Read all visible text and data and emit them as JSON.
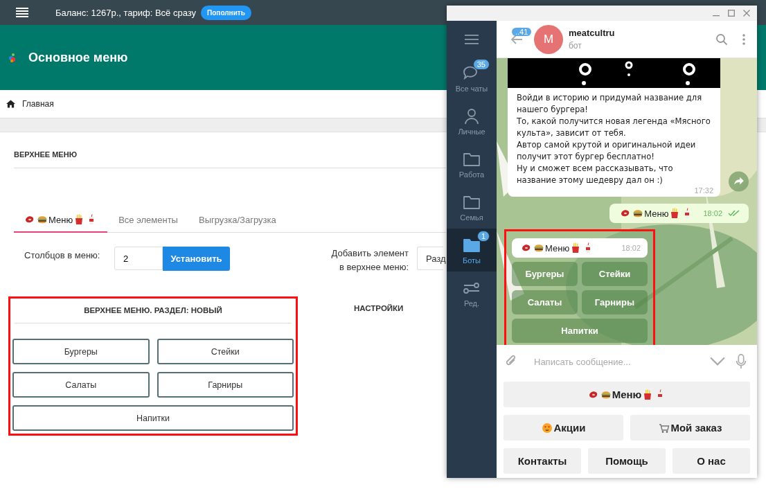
{
  "top_bar": {
    "balance": "Баланс: 1267р., тариф: Всё сразу",
    "topup_button": "Пополнить"
  },
  "header": {
    "title": "Основное меню"
  },
  "breadcrumb": {
    "label": "Главная"
  },
  "card": {
    "title": "ВЕРХНЕЕ МЕНЮ",
    "tabs": [
      {
        "label": "Меню",
        "kind": "emoji",
        "selected": true
      },
      {
        "label": "Все элементы",
        "kind": "text",
        "selected": false
      },
      {
        "label": "Выгрузка/Загрузка",
        "kind": "text",
        "selected": false
      }
    ],
    "columns_label": "Столбцов в меню:",
    "columns_value": "2",
    "set_button": "Установить",
    "add_label_lines": [
      "Добавить элемент",
      "в верхнее меню:"
    ],
    "add_select": "Разд",
    "section": {
      "title": "ВЕРХНЕЕ МЕНЮ. РАЗДЕЛ: НОВЫЙ",
      "highlighted": true,
      "rows": [
        [
          "Бургеры",
          "Стейки"
        ],
        [
          "Салаты",
          "Гарниры"
        ],
        [
          "Напитки"
        ]
      ]
    },
    "settings_title": "НАСТРОЙКИ"
  },
  "telegram": {
    "sidebar": [
      {
        "label": "Все чаты",
        "badge": "35",
        "selected": false
      },
      {
        "label": "Личные",
        "selected": false
      },
      {
        "label": "Работа",
        "selected": false
      },
      {
        "label": "Семья",
        "selected": false
      },
      {
        "label": "Боты",
        "badge": "1",
        "selected": true
      },
      {
        "label": "Ред.",
        "selected": false
      }
    ],
    "chat": {
      "back_badge": "..41",
      "avatar_letter": "M",
      "name": "meatcultru",
      "status": "бот"
    },
    "messages": [
      {
        "kind": "incoming-photo",
        "paragraphs": [
          "Войди в историю и придумай название для нашего бургера!",
          "То, какой получится новая легенда «Мясного культа», зависит от тебя.",
          "Автор самой крутой и оригинальной идеи получит этот бургер бесплатно!",
          "Ну и сможет всем рассказывать, что название этому шедевру дал он :)"
        ],
        "time": "17:32"
      },
      {
        "kind": "outgoing",
        "text": "Меню",
        "time": "18:02",
        "read": true
      },
      {
        "kind": "bot-keyboard",
        "text": "Меню",
        "time": "18:02",
        "highlighted": true,
        "rows": [
          [
            "Бургеры",
            "Стейки"
          ],
          [
            "Салаты",
            "Гарниры"
          ],
          [
            "Напитки"
          ]
        ]
      }
    ],
    "composer": {
      "placeholder": "Написать сообщение..."
    },
    "keyboard": [
      [
        {
          "label": "Меню",
          "kind": "menu"
        }
      ],
      [
        {
          "label": "Акции",
          "kind": "promo"
        },
        {
          "label": "Мой заказ",
          "kind": "order"
        }
      ],
      [
        {
          "label": "Контакты",
          "kind": "text"
        },
        {
          "label": "Помощь",
          "kind": "text"
        },
        {
          "label": "О нас",
          "kind": "text"
        }
      ]
    ]
  }
}
